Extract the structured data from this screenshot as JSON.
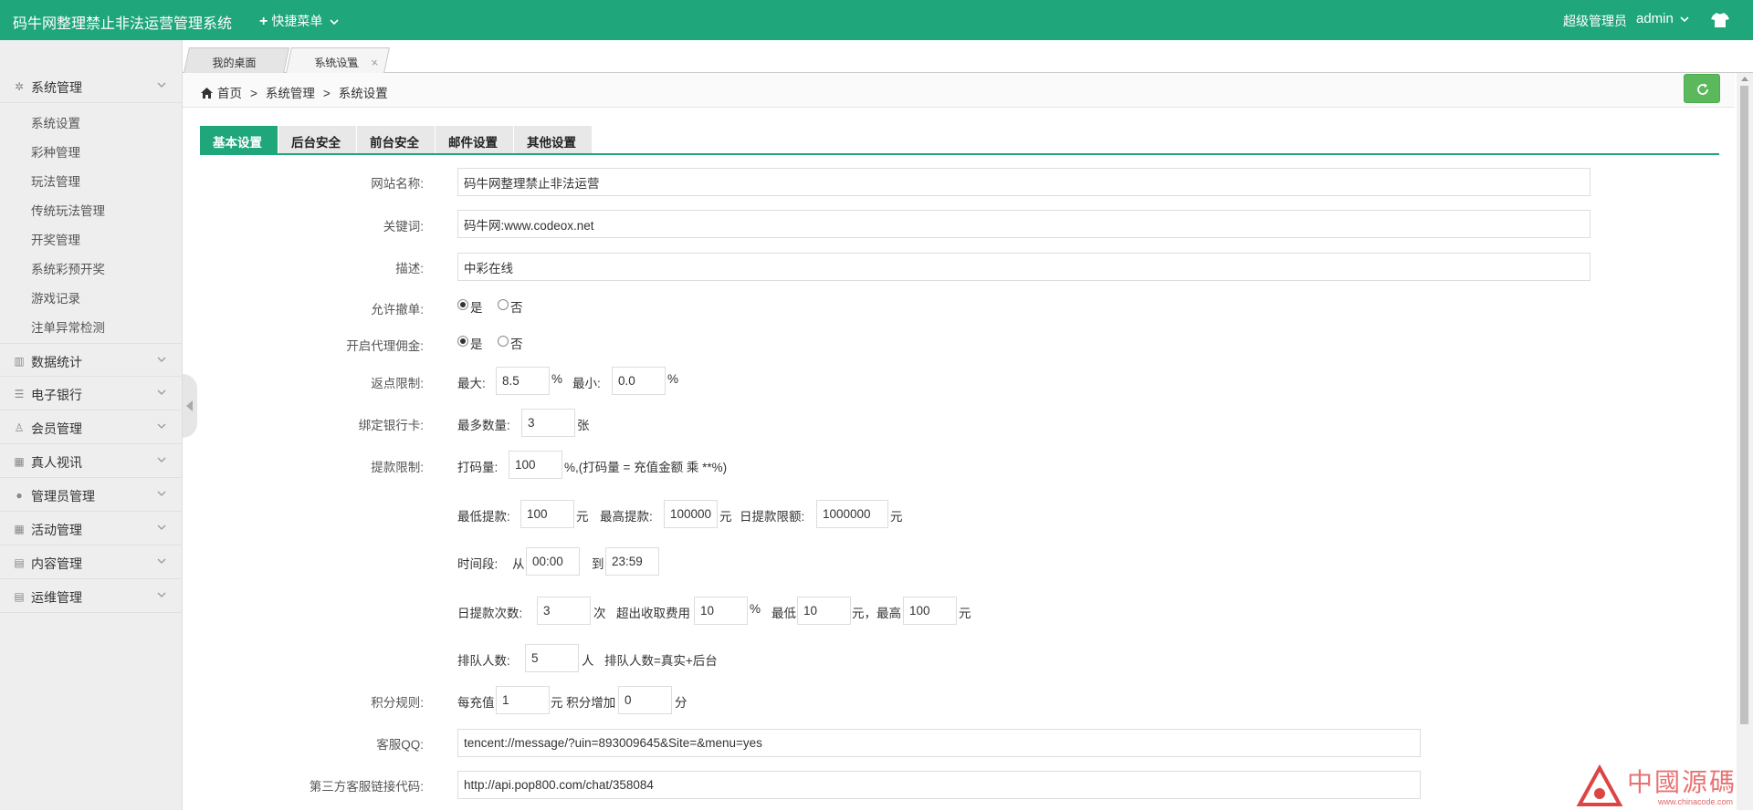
{
  "header": {
    "app_title": "码牛网整理禁止非法运营管理系统",
    "quick_menu": "快捷菜单",
    "role": "超级管理员",
    "user": "admin"
  },
  "sidebar": {
    "groups": [
      {
        "label": "系统管理",
        "icon": "gear-icon"
      },
      {
        "label": "数据统计",
        "icon": "chart-icon"
      },
      {
        "label": "电子银行",
        "icon": "list-icon"
      },
      {
        "label": "会员管理",
        "icon": "user-outline-icon"
      },
      {
        "label": "真人视讯",
        "icon": "calendar-icon"
      },
      {
        "label": "管理员管理",
        "icon": "user-icon"
      },
      {
        "label": "活动管理",
        "icon": "calendar-icon"
      },
      {
        "label": "内容管理",
        "icon": "book-icon"
      },
      {
        "label": "运维管理",
        "icon": "book-icon"
      }
    ],
    "sub_items": [
      "系统设置",
      "彩种管理",
      "玩法管理",
      "传统玩法管理",
      "开奖管理",
      "系统彩预开奖",
      "游戏记录",
      "注单异常检测"
    ]
  },
  "page_tabs": [
    {
      "label": "我的桌面"
    },
    {
      "label": "系统设置",
      "close": "×"
    }
  ],
  "breadcrumb": {
    "home": "首页",
    "level1": "系统管理",
    "level2": "系统设置",
    "sep": ">"
  },
  "form_tabs": [
    "基本设置",
    "后台安全",
    "前台安全",
    "邮件设置",
    "其他设置"
  ],
  "form": {
    "site_name": {
      "label": "网站名称:",
      "value": "码牛网整理禁止非法运营"
    },
    "keywords": {
      "label": "关键词:",
      "value": "码牛网:www.codeox.net"
    },
    "description": {
      "label": "描述:",
      "value": "中彩在线"
    },
    "allow_cancel": {
      "label": "允许撤单:",
      "yes": "是",
      "no": "否",
      "selected": "yes"
    },
    "agent_commission": {
      "label": "开启代理佣金:",
      "yes": "是",
      "no": "否",
      "selected": "yes"
    },
    "rebate": {
      "label": "返点限制:",
      "max_label": "最大:",
      "max": "8.5",
      "min_label": "最小:",
      "min": "0.0",
      "unit": "%"
    },
    "bank_card": {
      "label": "绑定银行卡:",
      "max_label": "最多数量:",
      "value": "3",
      "unit": "张"
    },
    "withdraw": {
      "label": "提款限制:",
      "bet_label": "打码量:",
      "bet_value": "100",
      "bet_note": "%,(打码量 = 充值金额 乘 **%)",
      "min_label": "最低提款:",
      "min_value": "100",
      "yuan": "元",
      "max_label": "最高提款:",
      "max_value": "100000",
      "daily_label": "日提款限额:",
      "daily_value": "1000000",
      "period_label": "时间段:",
      "from_label": "从",
      "from_value": "00:00",
      "to_label": "到",
      "to_value": "23:59",
      "times_label": "日提款次数:",
      "times_value": "3",
      "times_unit": "次",
      "fee_label": "超出收取费用",
      "fee_value": "10",
      "fee_unit": "%",
      "fee_min_label": "最低",
      "fee_min": "10",
      "fee_max_label": "元，最高",
      "fee_max": "100",
      "queue_label": "排队人数:",
      "queue_value": "5",
      "queue_unit": "人",
      "queue_note": "排队人数=真实+后台"
    },
    "points": {
      "label": "积分规则:",
      "per_label": "每充值",
      "per_value": "1",
      "mid_label": "元 积分增加",
      "add_value": "0",
      "unit": "分"
    },
    "qq": {
      "label": "客服QQ:",
      "value": "tencent://message/?uin=893009645&Site=&menu=yes"
    },
    "third_party": {
      "label": "第三方客服链接代码:",
      "value": "http://api.pop800.com/chat/358084"
    }
  },
  "watermark": {
    "text": "中國源碼",
    "url": "www.chinacode.com"
  },
  "colors": {
    "brand": "#1fa67a",
    "refresh": "#5cb85c"
  }
}
